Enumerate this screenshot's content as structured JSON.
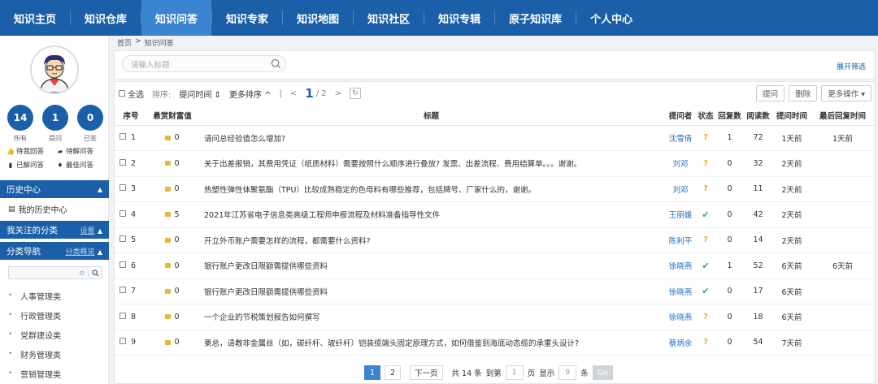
{
  "nav": [
    {
      "label": "知识主页",
      "active": false
    },
    {
      "label": "知识仓库",
      "active": false
    },
    {
      "label": "知识问答",
      "active": true
    },
    {
      "label": "知识专家",
      "active": false
    },
    {
      "label": "知识地图",
      "active": false
    },
    {
      "label": "知识社区",
      "active": false
    },
    {
      "label": "知识专辑",
      "active": false
    },
    {
      "label": "原子知识库",
      "active": false
    },
    {
      "label": "个人中心",
      "active": false
    }
  ],
  "sidebar": {
    "stats": [
      {
        "value": "14",
        "label": "所有"
      },
      {
        "value": "1",
        "label": "提问"
      },
      {
        "value": "0",
        "label": "已答"
      }
    ],
    "quick_links": [
      {
        "icon": "thumb-icon",
        "label": "待我回答"
      },
      {
        "icon": "message-icon",
        "label": "待解问答"
      },
      {
        "icon": "book-icon",
        "label": "已解问答"
      },
      {
        "icon": "flame-icon",
        "label": "最佳问答"
      }
    ],
    "history_title": "历史中心",
    "history_item": "我的历史中心",
    "followed_title": "我关注的分类",
    "followed_link": "设置",
    "category_title": "分类导航",
    "category_link": "分类概览",
    "categories": [
      "人事管理类",
      "行政管理类",
      "党群建设类",
      "财务管理类",
      "营销管理类"
    ]
  },
  "breadcrumb": [
    "首页",
    ">",
    "知识问答"
  ],
  "filter": {
    "search_placeholder": "请输入标题",
    "expand_label": "展开筛选"
  },
  "toolbar": {
    "select_all": "全选",
    "sort_label": "排序:",
    "sort_field": "提问时间 ⇕",
    "more_sort": "更多排序 ^",
    "prev": "<",
    "current_page": "1",
    "total_pages": "/ 2",
    "next": ">",
    "ask": "提问",
    "delete": "删除",
    "more_ops": "更多操作 ▾"
  },
  "columns": [
    "序号",
    "悬赏财富值",
    "标题",
    "提问者",
    "状态",
    "回复数",
    "阅读数",
    "提问时间",
    "最后回复时间"
  ],
  "rows": [
    {
      "seq": "1",
      "reward": "0",
      "title": "请问总经验值怎么增加?",
      "asker": "沈雪倩",
      "status": "pending",
      "replies": "1",
      "reads": "72",
      "asked": "1天前",
      "last_reply": "1天前"
    },
    {
      "seq": "2",
      "reward": "0",
      "title": "关于出差报销，其费用凭证（纸质材料）需要按照什么顺序进行叠放? 发票、出差流程、费用结算单。。。谢谢。",
      "asker": "刘邓",
      "status": "pending",
      "replies": "0",
      "reads": "32",
      "asked": "2天前",
      "last_reply": ""
    },
    {
      "seq": "3",
      "reward": "0",
      "title": "热塑性弹性体聚氨酯（TPU）比较成熟稳定的色母料有哪些推荐，包括牌号、厂家什么的，谢谢。",
      "asker": "刘邓",
      "status": "pending",
      "replies": "0",
      "reads": "11",
      "asked": "2天前",
      "last_reply": ""
    },
    {
      "seq": "4",
      "reward": "5",
      "title": "2021年江苏省电子信息类高级工程师申报流程及材料准备指导性文件",
      "asker": "王丽媛",
      "status": "solved",
      "replies": "0",
      "reads": "42",
      "asked": "2天前",
      "last_reply": ""
    },
    {
      "seq": "5",
      "reward": "0",
      "title": "开立外币账户需要怎样的流程，都需要什么资料?",
      "asker": "陈利平",
      "status": "pending",
      "replies": "0",
      "reads": "14",
      "asked": "2天前",
      "last_reply": ""
    },
    {
      "seq": "6",
      "reward": "0",
      "title": "银行账户更改日限额需提供哪些资料",
      "asker": "徐晓燕",
      "status": "solved",
      "replies": "1",
      "reads": "52",
      "asked": "6天前",
      "last_reply": "6天前"
    },
    {
      "seq": "7",
      "reward": "0",
      "title": "银行账户更改日限额需提供哪些资料",
      "asker": "徐晓燕",
      "status": "solved",
      "replies": "0",
      "reads": "17",
      "asked": "6天前",
      "last_reply": ""
    },
    {
      "seq": "8",
      "reward": "0",
      "title": "一个企业的节税策划报告如何撰写",
      "asker": "徐晓燕",
      "status": "pending",
      "replies": "0",
      "reads": "18",
      "asked": "6天前",
      "last_reply": ""
    },
    {
      "seq": "9",
      "reward": "0",
      "title": "栗总，请教非金属丝（如，碳纤杆、玻纤杆）铠装缆端头固定原理方式，如何借鉴到海底动态缆的承重头设计?",
      "asker": "蔡炳余",
      "status": "pending",
      "replies": "0",
      "reads": "54",
      "asked": "7天前",
      "last_reply": ""
    }
  ],
  "status_marks": {
    "pending": "?",
    "solved": "✔"
  },
  "pagination": {
    "pages": [
      "1",
      "2"
    ],
    "next": "下一页",
    "total": "共 14 条",
    "goto": "到第",
    "page_input": "1",
    "page_unit": "页",
    "show": "显示",
    "size_input": "9",
    "size_unit": "条",
    "go": "Go"
  },
  "colors": {
    "primary": "#1b5fa8",
    "active_tab": "#3a84d0",
    "link": "#1b6fc8",
    "coin": "#e6b73a",
    "solved": "#3aa655",
    "pending": "#e1b12c"
  }
}
